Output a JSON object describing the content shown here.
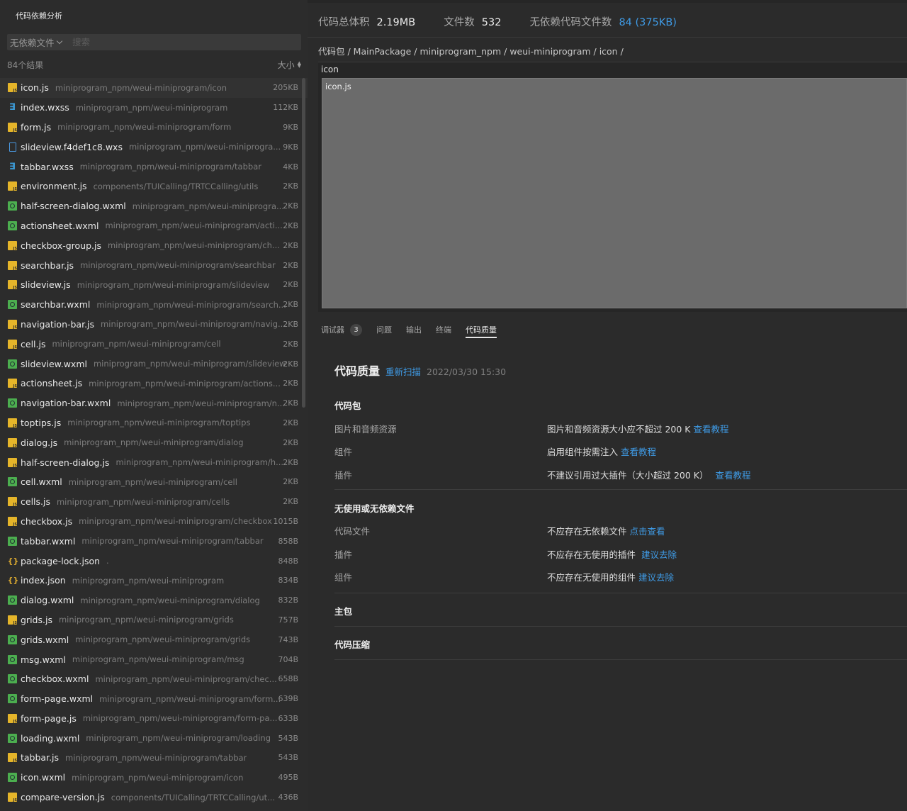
{
  "left": {
    "title": "代码依赖分析",
    "filter_label": "无依赖文件",
    "search_placeholder": "搜索",
    "result_count": "84个结果",
    "sort_label": "大小"
  },
  "files": [
    {
      "name": "icon.js",
      "path": "miniprogram_npm/weui-miniprogram/icon",
      "size": "205KB",
      "type": "js"
    },
    {
      "name": "index.wxss",
      "path": "miniprogram_npm/weui-miniprogram",
      "size": "112KB",
      "type": "wxss"
    },
    {
      "name": "form.js",
      "path": "miniprogram_npm/weui-miniprogram/form",
      "size": "9KB",
      "type": "js"
    },
    {
      "name": "slideview.f4def1c8.wxs",
      "path": "miniprogram_npm/weui-miniprogra...",
      "size": "9KB",
      "type": "doc"
    },
    {
      "name": "tabbar.wxss",
      "path": "miniprogram_npm/weui-miniprogram/tabbar",
      "size": "4KB",
      "type": "wxss"
    },
    {
      "name": "environment.js",
      "path": "components/TUICalling/TRTCCalling/utils",
      "size": "2KB",
      "type": "js"
    },
    {
      "name": "half-screen-dialog.wxml",
      "path": "miniprogram_npm/weui-miniprogra...",
      "size": "2KB",
      "type": "wxml"
    },
    {
      "name": "actionsheet.wxml",
      "path": "miniprogram_npm/weui-miniprogram/acti...",
      "size": "2KB",
      "type": "wxml"
    },
    {
      "name": "checkbox-group.js",
      "path": "miniprogram_npm/weui-miniprogram/ch...",
      "size": "2KB",
      "type": "js"
    },
    {
      "name": "searchbar.js",
      "path": "miniprogram_npm/weui-miniprogram/searchbar",
      "size": "2KB",
      "type": "js"
    },
    {
      "name": "slideview.js",
      "path": "miniprogram_npm/weui-miniprogram/slideview",
      "size": "2KB",
      "type": "js"
    },
    {
      "name": "searchbar.wxml",
      "path": "miniprogram_npm/weui-miniprogram/search...",
      "size": "2KB",
      "type": "wxml"
    },
    {
      "name": "navigation-bar.js",
      "path": "miniprogram_npm/weui-miniprogram/navig...",
      "size": "2KB",
      "type": "js"
    },
    {
      "name": "cell.js",
      "path": "miniprogram_npm/weui-miniprogram/cell",
      "size": "2KB",
      "type": "js"
    },
    {
      "name": "slideview.wxml",
      "path": "miniprogram_npm/weui-miniprogram/slideview",
      "size": "2KB",
      "type": "wxml"
    },
    {
      "name": "actionsheet.js",
      "path": "miniprogram_npm/weui-miniprogram/actions...",
      "size": "2KB",
      "type": "js"
    },
    {
      "name": "navigation-bar.wxml",
      "path": "miniprogram_npm/weui-miniprogram/n...",
      "size": "2KB",
      "type": "wxml"
    },
    {
      "name": "toptips.js",
      "path": "miniprogram_npm/weui-miniprogram/toptips",
      "size": "2KB",
      "type": "js"
    },
    {
      "name": "dialog.js",
      "path": "miniprogram_npm/weui-miniprogram/dialog",
      "size": "2KB",
      "type": "js"
    },
    {
      "name": "half-screen-dialog.js",
      "path": "miniprogram_npm/weui-miniprogram/h...",
      "size": "2KB",
      "type": "js"
    },
    {
      "name": "cell.wxml",
      "path": "miniprogram_npm/weui-miniprogram/cell",
      "size": "2KB",
      "type": "wxml"
    },
    {
      "name": "cells.js",
      "path": "miniprogram_npm/weui-miniprogram/cells",
      "size": "2KB",
      "type": "js"
    },
    {
      "name": "checkbox.js",
      "path": "miniprogram_npm/weui-miniprogram/checkbox",
      "size": "1015B",
      "type": "js"
    },
    {
      "name": "tabbar.wxml",
      "path": "miniprogram_npm/weui-miniprogram/tabbar",
      "size": "858B",
      "type": "wxml"
    },
    {
      "name": "package-lock.json",
      "path": ".",
      "size": "848B",
      "type": "json"
    },
    {
      "name": "index.json",
      "path": "miniprogram_npm/weui-miniprogram",
      "size": "834B",
      "type": "json"
    },
    {
      "name": "dialog.wxml",
      "path": "miniprogram_npm/weui-miniprogram/dialog",
      "size": "832B",
      "type": "wxml"
    },
    {
      "name": "grids.js",
      "path": "miniprogram_npm/weui-miniprogram/grids",
      "size": "757B",
      "type": "js"
    },
    {
      "name": "grids.wxml",
      "path": "miniprogram_npm/weui-miniprogram/grids",
      "size": "743B",
      "type": "wxml"
    },
    {
      "name": "msg.wxml",
      "path": "miniprogram_npm/weui-miniprogram/msg",
      "size": "704B",
      "type": "wxml"
    },
    {
      "name": "checkbox.wxml",
      "path": "miniprogram_npm/weui-miniprogram/chec...",
      "size": "658B",
      "type": "wxml"
    },
    {
      "name": "form-page.wxml",
      "path": "miniprogram_npm/weui-miniprogram/form...",
      "size": "639B",
      "type": "wxml"
    },
    {
      "name": "form-page.js",
      "path": "miniprogram_npm/weui-miniprogram/form-pa...",
      "size": "633B",
      "type": "js"
    },
    {
      "name": "loading.wxml",
      "path": "miniprogram_npm/weui-miniprogram/loading",
      "size": "543B",
      "type": "wxml"
    },
    {
      "name": "tabbar.js",
      "path": "miniprogram_npm/weui-miniprogram/tabbar",
      "size": "543B",
      "type": "js"
    },
    {
      "name": "icon.wxml",
      "path": "miniprogram_npm/weui-miniprogram/icon",
      "size": "495B",
      "type": "wxml"
    },
    {
      "name": "compare-version.js",
      "path": "components/TUICalling/TRTCCalling/ut...",
      "size": "436B",
      "type": "js"
    }
  ],
  "stats": {
    "total_size_label": "代码总体积",
    "total_size": "2.19MB",
    "file_count_label": "文件数",
    "file_count": "532",
    "unused_label": "无依赖代码文件数",
    "unused_value": "84 (375KB)"
  },
  "breadcrumb": "代码包 / MainPackage / miniprogram_npm / weui-miniprogram / icon /",
  "treemap": {
    "label": "icon",
    "cell_label": "icon.js"
  },
  "tabs": {
    "debugger": "调试器",
    "debugger_badge": "3",
    "problems": "问题",
    "output": "输出",
    "terminal": "终端",
    "quality": "代码质量"
  },
  "quality": {
    "title": "代码质量",
    "rescan": "重新扫描",
    "scan_time": "2022/03/30 15:30",
    "sections": {
      "package": {
        "title": "代码包",
        "items": [
          {
            "label": "图片和音频资源",
            "desc": "图片和音频资源大小应不超过 200 K",
            "link": "查看教程"
          },
          {
            "label": "组件",
            "desc": "启用组件按需注入",
            "link": "查看教程"
          },
          {
            "label": "插件",
            "desc": "不建议引用过大插件（大小超过 200 K）",
            "link": "查看教程"
          }
        ]
      },
      "unused": {
        "title": "无使用或无依赖文件",
        "items": [
          {
            "label": "代码文件",
            "desc": "不应存在无依赖文件",
            "link": "点击查看"
          },
          {
            "label": "插件",
            "desc": "不应存在无使用的插件",
            "link": "建议去除"
          },
          {
            "label": "组件",
            "desc": "不应存在无使用的组件",
            "link": "建议去除"
          }
        ]
      },
      "main": {
        "title": "主包"
      },
      "compress": {
        "title": "代码压缩"
      }
    }
  },
  "colors": {
    "accent": "#3f9be6",
    "js_icon": "#e5b52a",
    "wxml_icon": "#4cae4f",
    "wxss_icon": "#3c9bd8",
    "json_icon": "#d9a830"
  }
}
